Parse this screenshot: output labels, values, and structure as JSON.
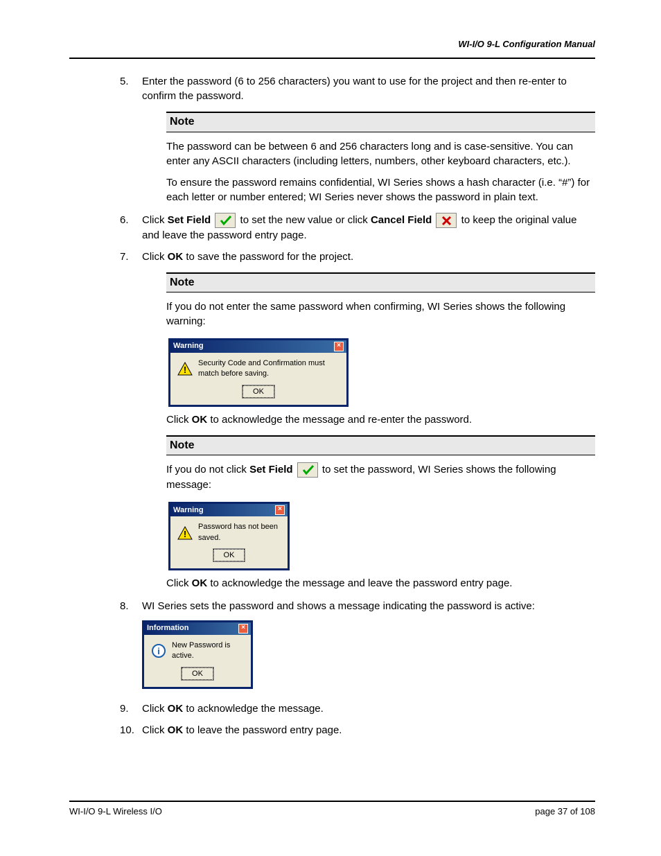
{
  "header": {
    "title": "WI-I/O 9-L Configuration Manual"
  },
  "footer": {
    "left": "WI-I/O 9-L Wireless I/O",
    "right": "page 37 of 108"
  },
  "steps": {
    "s5": "Enter the password (6 to 256 characters) you want to use for the project and then re-enter to confirm the password.",
    "s6a": "Click ",
    "s6_setfield": "Set Field",
    "s6b": " to set the new value or click ",
    "s6_cancelfield": "Cancel Field",
    "s6c": " to keep the original value and leave the password entry page.",
    "s7a": "Click ",
    "s7_ok": "OK",
    "s7b": " to save the password for the project.",
    "s8": "WI Series sets the password and shows a message indicating the password is active:",
    "s9a": "Click ",
    "s9_ok": "OK",
    "s9b": " to acknowledge the message.",
    "s10a": "Click ",
    "s10_ok": "OK",
    "s10b": " to leave the password entry page."
  },
  "notes": {
    "label": "Note",
    "n1": {
      "p1": "The password can be between 6 and 256 characters long and is case-sensitive. You can enter any ASCII characters (including letters, numbers, other keyboard characters, etc.).",
      "p2": "To ensure the password remains confidential, WI Series shows a hash character (i.e. “#”) for each letter or number entered; WI Series never shows the password in plain text."
    },
    "n2": {
      "intro": "If you do not enter the same password when confirming, WI Series shows the following warning:",
      "ack_a": "Click ",
      "ack_ok": "OK",
      "ack_b": " to acknowledge the message and re-enter the password."
    },
    "n3": {
      "intro_a": "If you do not click ",
      "intro_setfield": "Set Field",
      "intro_b": " to set the password, WI Series shows the following message:",
      "ack_a": "Click ",
      "ack_ok": "OK",
      "ack_b": " to acknowledge the message and leave the password entry page."
    }
  },
  "dialogs": {
    "warn1": {
      "title": "Warning",
      "msg": "Security Code and Confirmation must match before saving.",
      "ok": "OK"
    },
    "warn2": {
      "title": "Warning",
      "msg": "Password has not been saved.",
      "ok": "OK"
    },
    "info": {
      "title": "Information",
      "msg": "New Password is active.",
      "ok": "OK"
    }
  }
}
